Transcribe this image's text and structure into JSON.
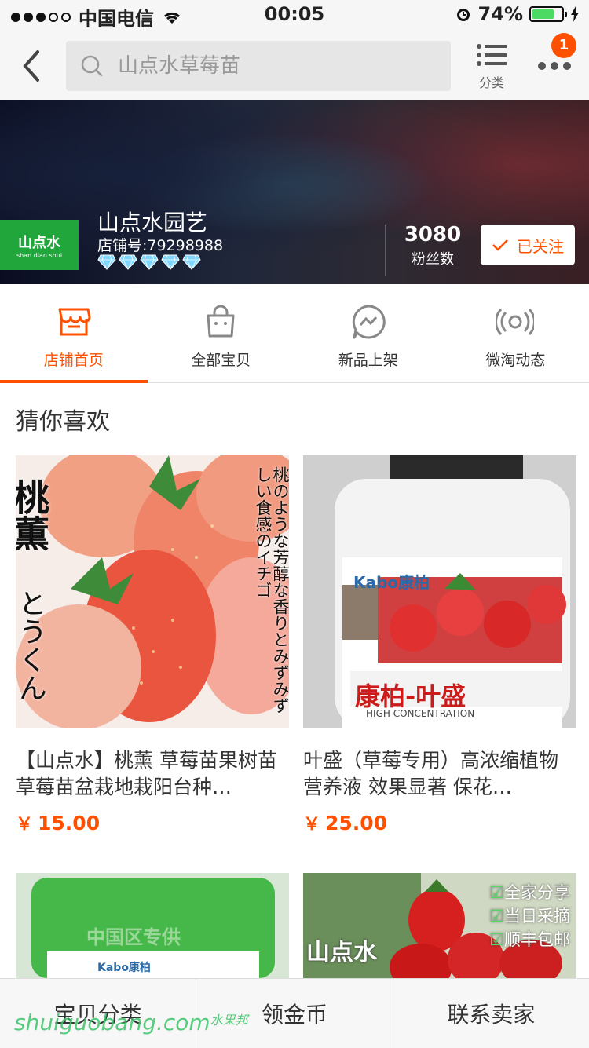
{
  "status_bar": {
    "carrier": "中国电信",
    "time": "00:05",
    "battery_percent": "74%",
    "battery_level": 0.74
  },
  "nav": {
    "search_placeholder": "山点水草莓苗",
    "category_label": "分类",
    "notification_count": "1"
  },
  "shop": {
    "logo_text": "山点水",
    "logo_subtext": "shan dian shui",
    "name": "山点水园艺",
    "id_label": "店铺号:79298988",
    "diamond_count": 5,
    "fans_count": "3080",
    "fans_label": "粉丝数",
    "follow_label": "已关注"
  },
  "tabs": [
    {
      "label": "店铺首页",
      "icon": "store-icon",
      "active": true
    },
    {
      "label": "全部宝贝",
      "icon": "shopping-bag-icon",
      "active": false
    },
    {
      "label": "新品上架",
      "icon": "lightning-chat-icon",
      "active": false
    },
    {
      "label": "微淘动态",
      "icon": "broadcast-icon",
      "active": false
    }
  ],
  "guess": {
    "title": "猜你喜欢",
    "products": [
      {
        "name": "【山点水】桃薰 草莓苗果树苗草莓苗盆栽地栽阳台种…",
        "currency": "￥",
        "price": "15.00",
        "img_text_vertical_big": "桃薫",
        "img_text_vertical_small": "とうくん",
        "img_text_right": "桃のような芳醇な香りとみずみずしい食感のイチゴ"
      },
      {
        "name": "叶盛（草莓专用）高浓缩植物营养液 效果显著 保花…",
        "currency": "￥",
        "price": "25.00",
        "img_brand": "Kabo康柏",
        "img_product": "康柏-叶盛",
        "img_sub": "HIGH CONCENTRATION"
      },
      {
        "img_top_text": "中国区专供",
        "img_brand": "Kabo康柏"
      },
      {
        "img_shop_text": "山点水",
        "img_bullets": [
          "全家分享",
          "当日采摘",
          "顺丰包邮"
        ]
      }
    ]
  },
  "bottom_bar": {
    "items": [
      "宝贝分类",
      "领金币",
      "联系卖家"
    ]
  },
  "watermark": {
    "text": "shuiguobang.com",
    "small": "水果邦"
  },
  "colors": {
    "accent": "#ff5000",
    "logo_green": "#20a63a",
    "diamond": "#7fd7ff"
  }
}
